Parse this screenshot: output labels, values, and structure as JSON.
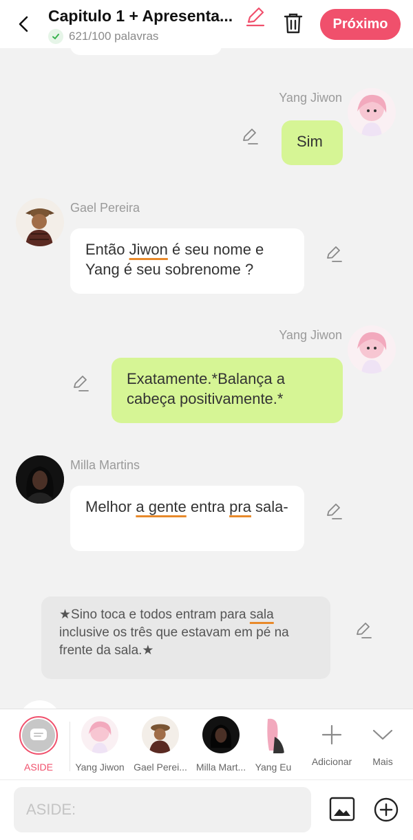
{
  "header": {
    "title": "Capitulo 1 + Apresenta...",
    "word_count": "621/100 palavras",
    "next_label": "Próximo"
  },
  "messages": [
    {
      "speaker": "Yang Jiwon",
      "side": "right",
      "text": "Sim"
    },
    {
      "speaker": "Gael Pereira",
      "side": "left",
      "text_parts": [
        "Então ",
        "Jiwon",
        " é seu nome e Yang é seu sobrenome ?"
      ]
    },
    {
      "speaker": "Yang Jiwon",
      "side": "right",
      "text": "Exatamente.*Balança a cabeça positivamente.*"
    },
    {
      "speaker": "Milla Martins",
      "side": "left",
      "text_parts": [
        "Melhor ",
        "a gente",
        " entra ",
        "pra",
        " sala-"
      ]
    },
    {
      "speaker": "ASIDE",
      "side": "center",
      "text_parts": [
        "★Sino toca e todos entram para ",
        "sala",
        " inclusive os três que estavam em pé na frente da sala.★"
      ]
    }
  ],
  "characters": [
    {
      "label": "ASIDE",
      "selected": true
    },
    {
      "label": "Yang Jiwon"
    },
    {
      "label": "Gael Perei..."
    },
    {
      "label": "Milla Mart..."
    },
    {
      "label": "Yang Eu"
    }
  ],
  "actions": {
    "add_label": "Adicionar",
    "more_label": "Mais"
  },
  "composer": {
    "placeholder": "ASIDE:"
  },
  "colors": {
    "accent": "#f0506c",
    "green_bubble": "#d6f595",
    "underline": "#e8892a"
  }
}
